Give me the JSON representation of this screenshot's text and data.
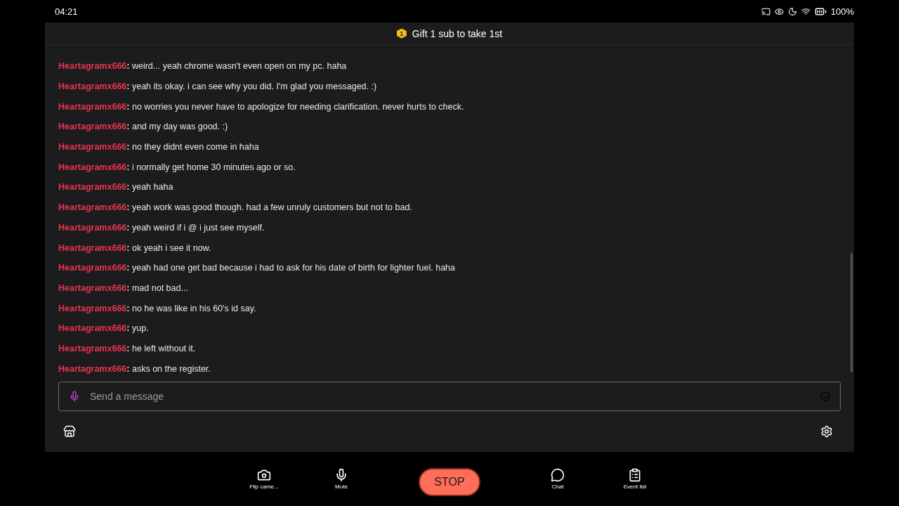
{
  "status_bar": {
    "time": "04:21",
    "battery": "100%"
  },
  "banner": {
    "text": "Gift 1 sub to take 1st",
    "badge": "1"
  },
  "messages": [
    {
      "user": "Heartagramx666",
      "separator": ":",
      "text": "weird... yeah chrome wasn't even open on my pc. haha"
    },
    {
      "user": "Heartagramx666",
      "separator": ":",
      "text": "yeah its okay. i can see why you did. I'm glad you messaged. :)"
    },
    {
      "user": "Heartagramx666",
      "separator": ":",
      "text": "no worries you never have to apologize for needing clarification. never hurts to check."
    },
    {
      "user": "Heartagramx666",
      "separator": ":",
      "text": "and my day was good. :)"
    },
    {
      "user": "Heartagramx666",
      "separator": ":",
      "text": "no they didnt even come in haha"
    },
    {
      "user": "Heartagramx666",
      "separator": ":",
      "text": "i normally get home 30 minutes ago or so."
    },
    {
      "user": "Heartagramx666",
      "separator": ":",
      "text": "yeah haha"
    },
    {
      "user": "Heartagramx666",
      "separator": ":",
      "text": "yeah work was good though. had a few unruly customers but not to bad."
    },
    {
      "user": "Heartagramx666",
      "separator": ":",
      "text": "yeah weird if i @ i just see myself."
    },
    {
      "user": "Heartagramx666",
      "separator": ":",
      "text": "ok yeah i see it now."
    },
    {
      "user": "Heartagramx666",
      "separator": ":",
      "text": "yeah had one get bad because i had to ask for his date of birth for lighter fuel. haha"
    },
    {
      "user": "Heartagramx666",
      "separator": ":",
      "text": "mad not bad..."
    },
    {
      "user": "Heartagramx666",
      "separator": ":",
      "text": "no he was like in his 60's id say."
    },
    {
      "user": "Heartagramx666",
      "separator": ":",
      "text": "yup."
    },
    {
      "user": "Heartagramx666",
      "separator": ":",
      "text": "he left without it."
    },
    {
      "user": "Heartagramx666",
      "separator": ":",
      "text": "asks on the register."
    }
  ],
  "input": {
    "placeholder": "Send a message"
  },
  "toolbar": [
    {
      "kind": "camera",
      "label": "Flip came..."
    },
    {
      "kind": "mic",
      "label": "Mute"
    },
    {
      "kind": "stop",
      "label": "STOP"
    },
    {
      "kind": "chat",
      "label": "Chat"
    },
    {
      "kind": "list",
      "label": "Event list"
    }
  ]
}
